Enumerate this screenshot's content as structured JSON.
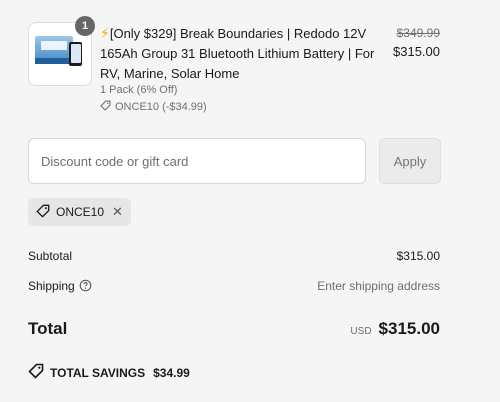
{
  "line_item": {
    "quantity": "1",
    "bolt": "⚡",
    "title": "[Only $329] Break Boundaries | Redodo 12V 165Ah Group 31 Bluetooth Lithium Battery | For RV, Marine, Solar Home",
    "variant": "1 Pack (6% Off)",
    "discount_code": "ONCE10 (-$34.99)",
    "original_price": "$349.99",
    "price": "$315.00"
  },
  "discount": {
    "placeholder": "Discount code or gift card",
    "value": "",
    "apply_label": "Apply",
    "applied_code": "ONCE10"
  },
  "summary": {
    "subtotal_label": "Subtotal",
    "subtotal_value": "$315.00",
    "shipping_label": "Shipping",
    "shipping_value": "Enter shipping address",
    "total_label": "Total",
    "currency": "USD",
    "total_value": "$315.00",
    "savings_label": "TOTAL SAVINGS",
    "savings_value": "$34.99"
  },
  "icons": {
    "tag": "tag-icon",
    "help": "help-circle-icon",
    "remove": "close-icon"
  }
}
